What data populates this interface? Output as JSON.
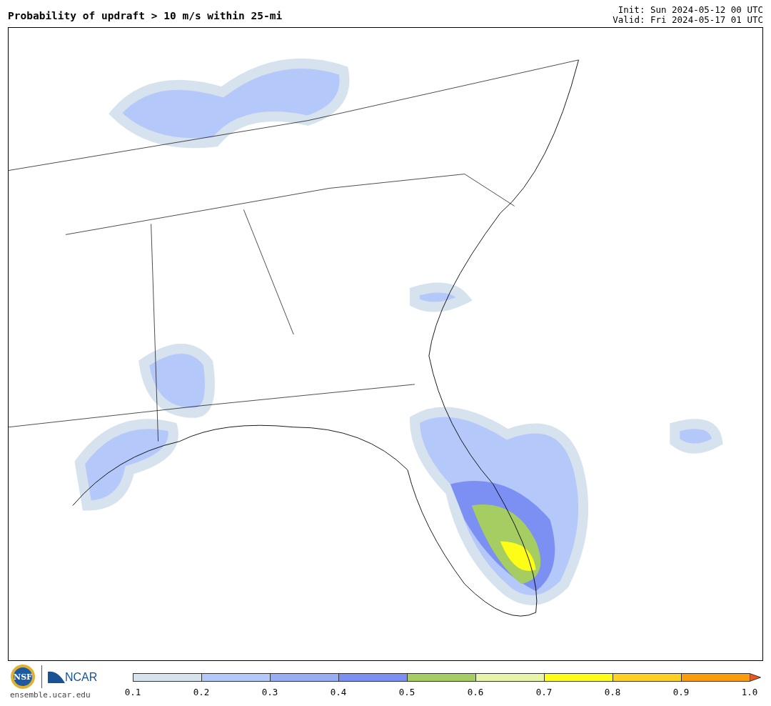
{
  "title": "Probability of updraft > 10 m/s within 25-mi",
  "init": "Init: Sun 2024-05-12 00 UTC",
  "valid": "Valid: Fri 2024-05-17 01 UTC",
  "logos": {
    "nsf": "NSF",
    "ncar": "NCAR",
    "site": "ensemble.ucar.edu"
  },
  "colorbar": {
    "bins": [
      {
        "color": "#d6e2ed"
      },
      {
        "color": "#b4c8fa"
      },
      {
        "color": "#97aef6"
      },
      {
        "color": "#7b90f2"
      },
      {
        "color": "#a6cd62"
      },
      {
        "color": "#e8f5a9"
      },
      {
        "color": "#fdfd17"
      },
      {
        "color": "#fdd022"
      },
      {
        "color": "#fb9c0b"
      }
    ],
    "extend": {
      "color": "#f0561a"
    },
    "ticks": [
      "0.1",
      "0.2",
      "0.3",
      "0.4",
      "0.5",
      "0.6",
      "0.7",
      "0.8",
      "0.9",
      "1.0"
    ]
  }
}
